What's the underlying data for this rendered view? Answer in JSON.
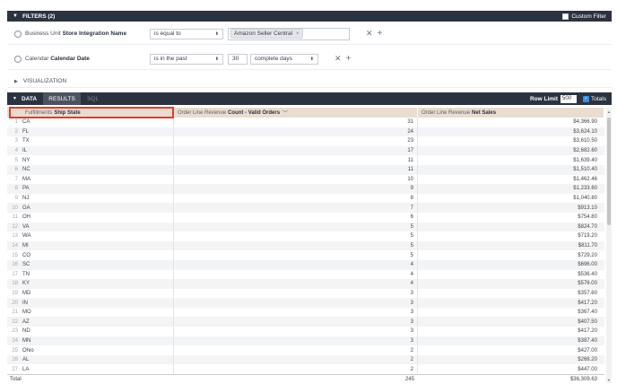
{
  "filters": {
    "title": "FILTERS (2)",
    "custom_filter_label": "Custom Filter",
    "rows": [
      {
        "view": "Business Unit",
        "field": "Store Integration Name",
        "operator": "is equal to",
        "tag": "Amazon Seller Central"
      },
      {
        "view": "Calendar",
        "field": "Calendar Date",
        "operator": "is in the past",
        "value": "30",
        "unit": "complete days"
      }
    ]
  },
  "visualization": {
    "label": "VISUALIZATION"
  },
  "data_bar": {
    "data_label": "DATA",
    "results_label": "RESULTS",
    "sql_label": "SQL",
    "row_limit_label": "Row Limit",
    "row_limit_value": "500",
    "totals_label": "Totals"
  },
  "table": {
    "columns": [
      {
        "view": "Fulfillments",
        "field": "Ship State"
      },
      {
        "view": "Order Line Revenue",
        "field": "Count - Valid Orders"
      },
      {
        "view": "Order Line Revenue",
        "field": "Net Sales"
      }
    ],
    "rows": [
      {
        "n": "1",
        "state": "CA",
        "count": "31",
        "sales": "$4,366.90"
      },
      {
        "n": "2",
        "state": "FL",
        "count": "24",
        "sales": "$3,624.10"
      },
      {
        "n": "3",
        "state": "TX",
        "count": "23",
        "sales": "$3,610.50"
      },
      {
        "n": "4",
        "state": "IL",
        "count": "17",
        "sales": "$2,682.60"
      },
      {
        "n": "5",
        "state": "NY",
        "count": "11",
        "sales": "$1,639.40"
      },
      {
        "n": "6",
        "state": "NC",
        "count": "11",
        "sales": "$1,510.40"
      },
      {
        "n": "7",
        "state": "MA",
        "count": "10",
        "sales": "$1,462.46"
      },
      {
        "n": "8",
        "state": "PA",
        "count": "9",
        "sales": "$1,233.60"
      },
      {
        "n": "9",
        "state": "NJ",
        "count": "8",
        "sales": "$1,040.80"
      },
      {
        "n": "10",
        "state": "GA",
        "count": "7",
        "sales": "$913.10"
      },
      {
        "n": "11",
        "state": "OH",
        "count": "6",
        "sales": "$754.80"
      },
      {
        "n": "12",
        "state": "VA",
        "count": "5",
        "sales": "$824.70"
      },
      {
        "n": "13",
        "state": "WA",
        "count": "5",
        "sales": "$719.20"
      },
      {
        "n": "14",
        "state": "MI",
        "count": "5",
        "sales": "$811.70"
      },
      {
        "n": "15",
        "state": "CO",
        "count": "5",
        "sales": "$729.20"
      },
      {
        "n": "16",
        "state": "SC",
        "count": "4",
        "sales": "$696.00"
      },
      {
        "n": "17",
        "state": "TN",
        "count": "4",
        "sales": "$536.40"
      },
      {
        "n": "18",
        "state": "KY",
        "count": "4",
        "sales": "$576.00"
      },
      {
        "n": "19",
        "state": "MD",
        "count": "3",
        "sales": "$357.60"
      },
      {
        "n": "20",
        "state": "IN",
        "count": "3",
        "sales": "$417.20"
      },
      {
        "n": "21",
        "state": "MO",
        "count": "3",
        "sales": "$367.40"
      },
      {
        "n": "22",
        "state": "AZ",
        "count": "3",
        "sales": "$407.50"
      },
      {
        "n": "23",
        "state": "ND",
        "count": "3",
        "sales": "$417.20"
      },
      {
        "n": "24",
        "state": "MN",
        "count": "3",
        "sales": "$387.40"
      },
      {
        "n": "25",
        "state": "Ohio",
        "count": "2",
        "sales": "$427.00"
      },
      {
        "n": "26",
        "state": "AL",
        "count": "2",
        "sales": "$268.20"
      },
      {
        "n": "27",
        "state": "LA",
        "count": "2",
        "sales": "$447.00"
      }
    ],
    "total": {
      "label": "Total",
      "count": "245",
      "sales": "$36,309.63"
    }
  }
}
